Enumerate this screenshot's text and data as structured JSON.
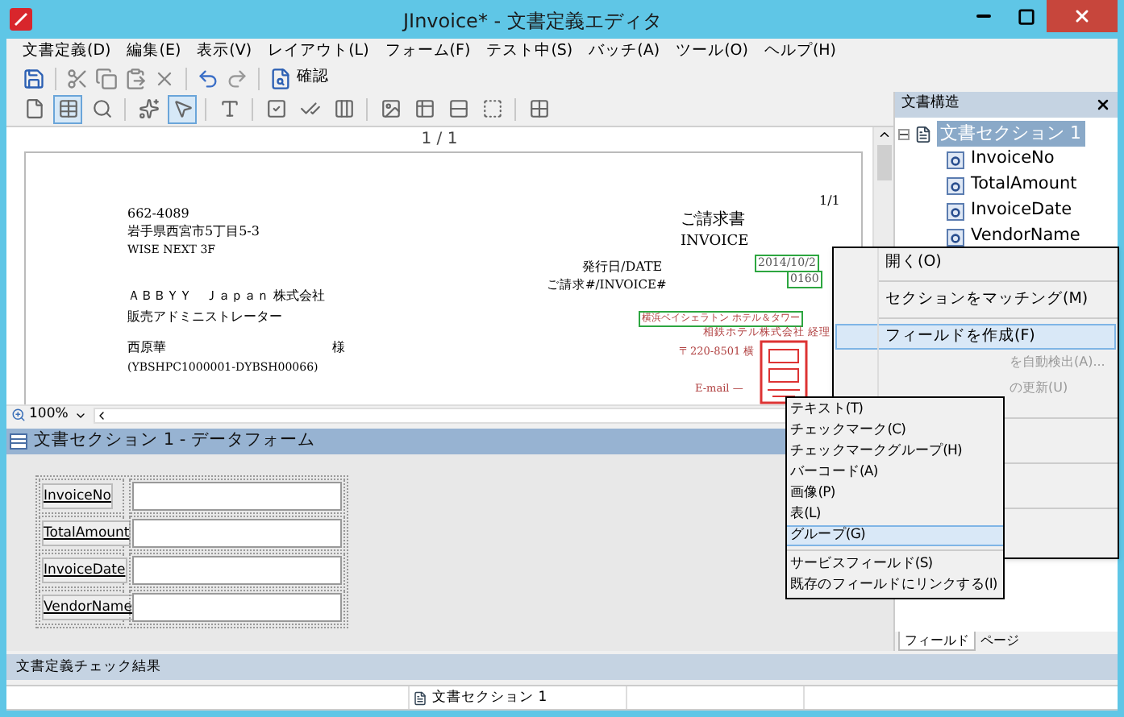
{
  "window": {
    "title": "JInvoice* - 文書定義エディタ"
  },
  "menu_bar": [
    "文書定義(D)",
    "編集(E)",
    "表示(V)",
    "レイアウト(L)",
    "フォーム(F)",
    "テスト中(S)",
    "バッチ(A)",
    "ツール(O)",
    "ヘルプ(H)"
  ],
  "toolbar_1": {
    "confirm_label": "確認"
  },
  "toolbar_2": [
    {
      "selected": false
    },
    {
      "selected": true
    },
    {
      "selected": false
    },
    {
      "selected": false
    },
    {
      "selected": true
    },
    {
      "selected": false
    },
    {
      "selected": false
    },
    {
      "selected": false
    },
    {
      "selected": false
    },
    {
      "selected": false
    },
    {
      "selected": false
    },
    {
      "selected": false
    },
    {
      "selected": false
    },
    {
      "selected": false
    }
  ],
  "document": {
    "page_indicator": "1 / 1",
    "zoom": "100%",
    "page": {
      "page_number": "1/1",
      "postal_code": "662-4089",
      "address": "岩手県西宮市5丁目5-3",
      "building": "WISE NEXT 3F",
      "company": "ＡＢＢＹＹ　Ｊａｐａｎ 株式会社",
      "role": "販売アドミニストレーター",
      "recipient": "西原華",
      "honorific": "様",
      "customer_id": "(YBSHPC1000001-DYBSH00066)",
      "title_ja": "ご請求書",
      "title_en": "INVOICE",
      "date_label": "発行日/DATE",
      "invoice_label": "ご請求#/INVOICE#",
      "date_value": "2014/10/2",
      "invoice_value": "0160",
      "issuer": "横浜ベイシェラトン ホテル＆タワー",
      "issuer_dept": "相鉄ホテル株式会社 経理",
      "issuer_address": "〒220-8501 横",
      "issuer_email": "E-mail —"
    }
  },
  "data_form": {
    "title": "文書セクション 1 - データフォーム",
    "fields": [
      {
        "label": "InvoiceNo"
      },
      {
        "label": "TotalAmount"
      },
      {
        "label": "InvoiceDate"
      },
      {
        "label": "VendorName"
      }
    ]
  },
  "structure_panel": {
    "title": "文書構造",
    "tree": [
      {
        "label": "文書セクション 1",
        "selected": true,
        "expanded": true,
        "children": [
          {
            "label": "InvoiceNo",
            "selected": false
          },
          {
            "label": "TotalAmount",
            "selected": false
          },
          {
            "label": "InvoiceDate",
            "selected": false
          },
          {
            "label": "VendorName",
            "selected": false
          }
        ]
      }
    ],
    "tabs": [
      {
        "label": "フィールド",
        "selected": true
      },
      {
        "label": "ページ",
        "selected": false
      }
    ]
  },
  "context_menu": {
    "items": [
      {
        "kind": "item",
        "label": "開く(O)",
        "selected": false,
        "disabled": false
      },
      {
        "kind": "separator"
      },
      {
        "kind": "item",
        "label": "セクションをマッチング(M)",
        "selected": false,
        "disabled": false
      },
      {
        "kind": "separator"
      },
      {
        "kind": "item",
        "label": "フィールドを作成(F)",
        "selected": true,
        "disabled": false
      },
      {
        "kind": "partial",
        "label": "を自動検出(A)...",
        "selected": false,
        "disabled": true
      },
      {
        "kind": "partial",
        "label": "の更新(U)",
        "selected": false,
        "disabled": true
      }
    ]
  },
  "submenu": {
    "items": [
      {
        "kind": "item",
        "label": "テキスト(T)",
        "selected": false
      },
      {
        "kind": "item",
        "label": "チェックマーク(C)",
        "selected": false
      },
      {
        "kind": "item",
        "label": "チェックマークグループ(H)",
        "selected": false
      },
      {
        "kind": "item",
        "label": "バーコード(A)",
        "selected": false
      },
      {
        "kind": "item",
        "label": "画像(P)",
        "selected": false
      },
      {
        "kind": "item",
        "label": "表(L)",
        "selected": false
      },
      {
        "kind": "item",
        "label": "グループ(G)",
        "selected": true
      },
      {
        "kind": "separator"
      },
      {
        "kind": "item",
        "label": "サービスフィールド(S)",
        "selected": false
      },
      {
        "kind": "item",
        "label": "既存のフィールドにリンクする(I)",
        "selected": false
      }
    ]
  },
  "check_results": {
    "title": "文書定義チェック結果",
    "rows": [
      {
        "section": "文書セクション 1"
      }
    ]
  }
}
